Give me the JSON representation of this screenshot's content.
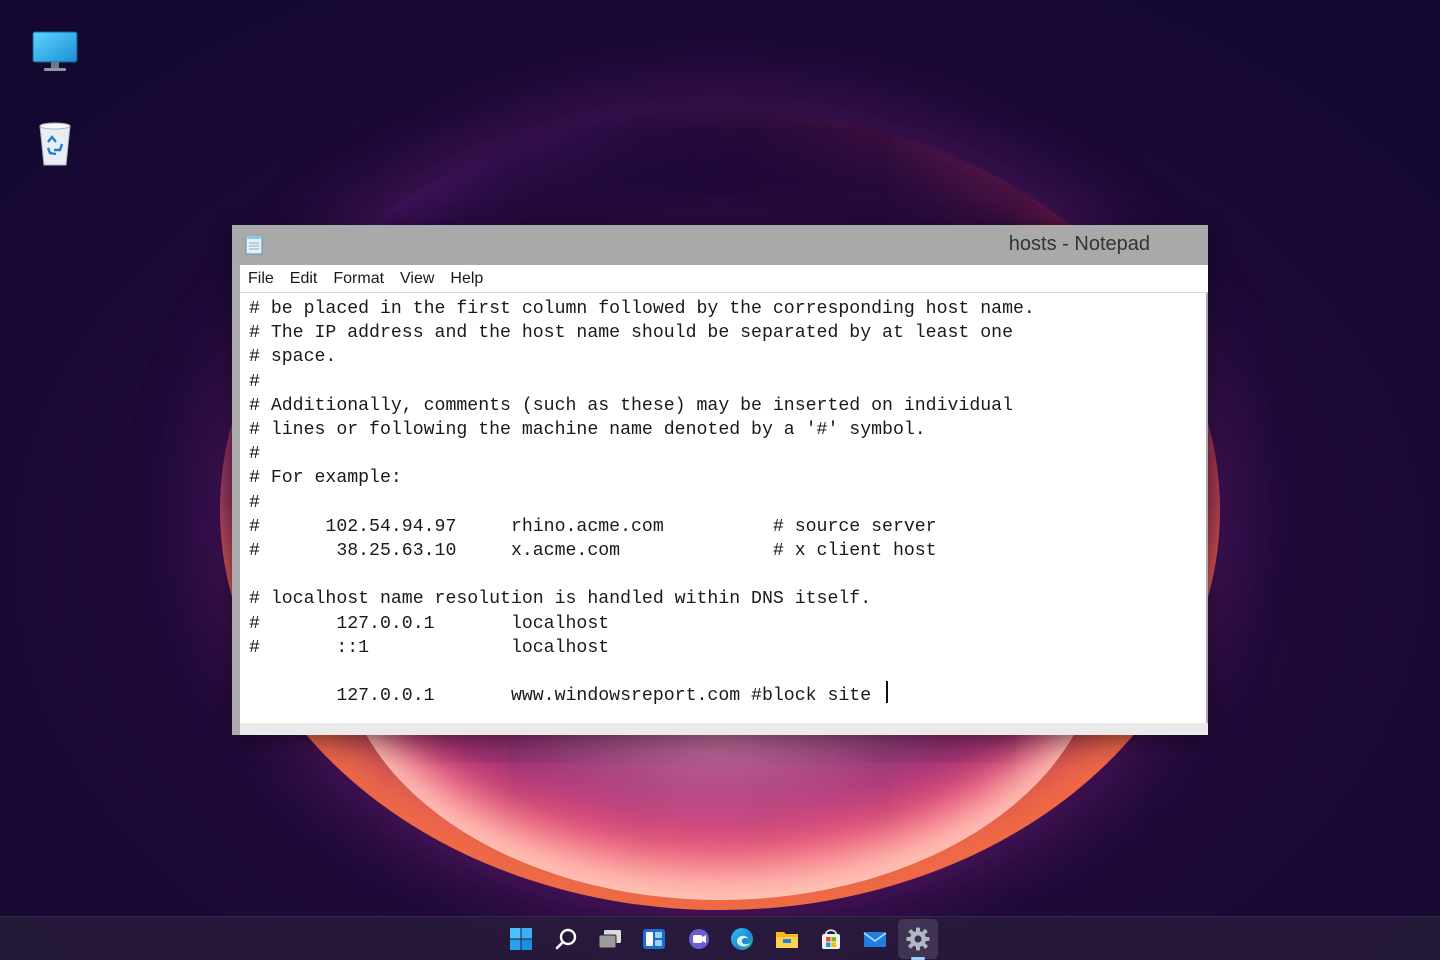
{
  "window": {
    "title": "hosts - Notepad",
    "app_icon": "notepad-icon"
  },
  "menu": {
    "file": "File",
    "edit": "Edit",
    "format": "Format",
    "view": "View",
    "help": "Help"
  },
  "editor": {
    "content": "# be placed in the first column followed by the corresponding host name.\n# The IP address and the host name should be separated by at least one\n# space.\n#\n# Additionally, comments (such as these) may be inserted on individual\n# lines or following the machine name denoted by a '#' symbol.\n#\n# For example:\n#\n#      102.54.94.97     rhino.acme.com          # source server\n#       38.25.63.10     x.acme.com              # x client host\n\n# localhost name resolution is handled within DNS itself.\n#       127.0.0.1       localhost\n#       ::1             localhost\n\n        127.0.0.1       www.windowsreport.com #block site "
  },
  "desktop_icons": [
    {
      "name": "this-pc-icon"
    },
    {
      "name": "recycle-bin-icon"
    }
  ],
  "taskbar": {
    "icons": [
      "start-icon",
      "search-icon",
      "task-view-icon",
      "widgets-icon",
      "chat-icon",
      "edge-icon",
      "file-explorer-icon",
      "store-icon",
      "mail-icon",
      "settings-icon"
    ],
    "active": "settings-icon"
  },
  "colors": {
    "accent": "#0078d4",
    "titlebar": "#a9a9a9",
    "taskbar": "#281c3c"
  }
}
